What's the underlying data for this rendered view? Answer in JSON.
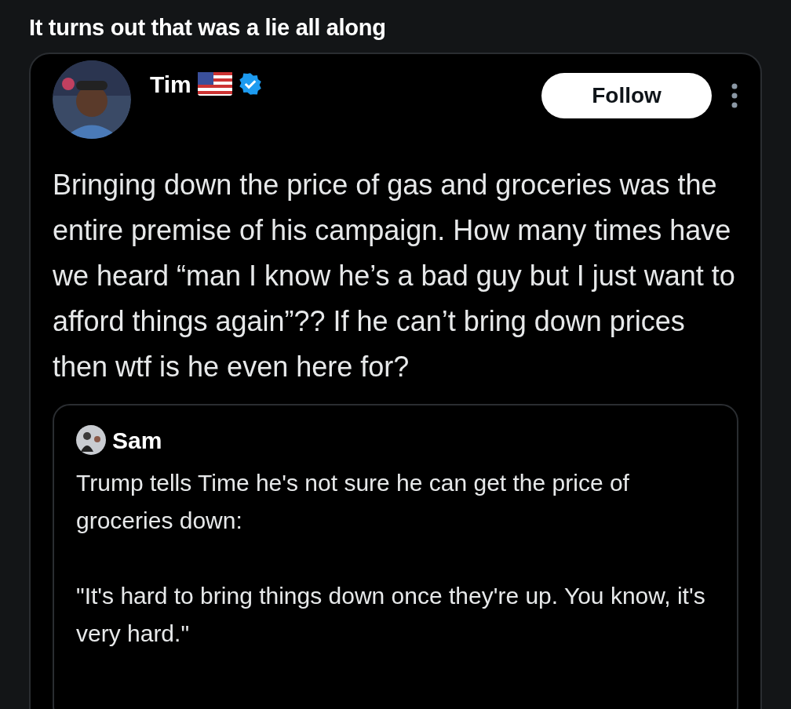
{
  "heading": "It turns out that was a lie all along",
  "post": {
    "author": {
      "name": "Tim",
      "verified": true
    },
    "follow_label": "Follow",
    "text": "Bringing down the price of gas and groceries was the entire premise of his campaign. How many times have we heard “man I know he’s a bad guy but I just want to afford things again”?? If he can’t bring down prices then wtf is he even here for?",
    "quote": {
      "author": {
        "name": "Sam"
      },
      "paragraphs": [
        "Trump tells Time he's not sure he can get the price of groceries down:",
        "\"It's hard to bring things down once they're up. You know, it's very hard.\""
      ]
    }
  }
}
